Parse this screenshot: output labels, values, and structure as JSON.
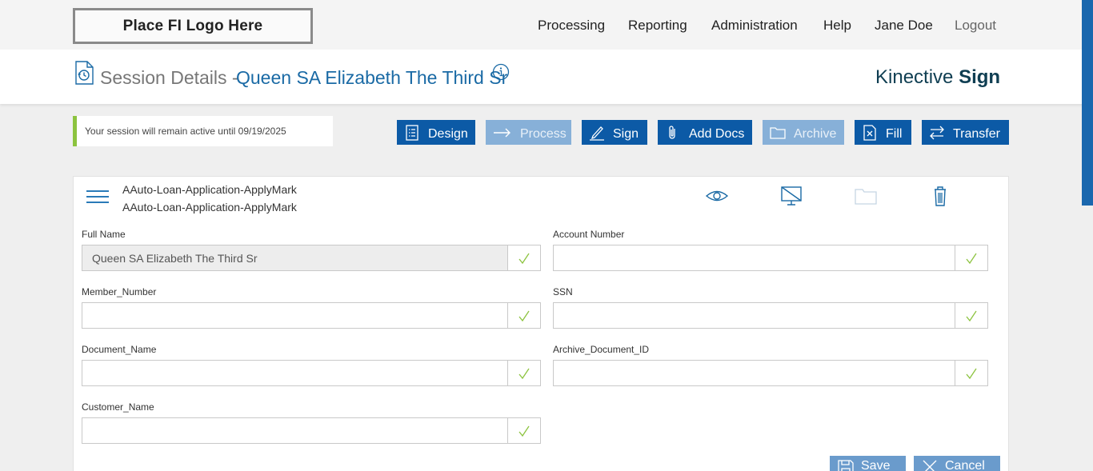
{
  "header": {
    "logo_text": "Place FI Logo Here",
    "nav": {
      "processing": "Processing",
      "reporting": "Reporting",
      "administration": "Administration",
      "help": "Help",
      "user": "Jane Doe",
      "logout": "Logout"
    }
  },
  "subheader": {
    "title_prefix": "Session Details -",
    "session_name": "Queen SA Elizabeth The Third Sr",
    "brand_light": "Kinective",
    "brand_bold": "Sign"
  },
  "session_notice": "Your session will remain active until 09/19/2025",
  "toolbar": {
    "design": "Design",
    "process": "Process",
    "sign": "Sign",
    "add_docs": "Add Docs",
    "archive": "Archive",
    "fill": "Fill",
    "transfer": "Transfer"
  },
  "document": {
    "line1": "AAuto-Loan-Application-ApplyMark",
    "line2": "AAuto-Loan-Application-ApplyMark"
  },
  "fields": {
    "full_name": {
      "label": "Full Name",
      "value": "Queen SA Elizabeth The Third Sr"
    },
    "account_number": {
      "label": "Account Number",
      "value": ""
    },
    "member_number": {
      "label": "Member_Number",
      "value": ""
    },
    "ssn": {
      "label": "SSN",
      "value": ""
    },
    "document_name": {
      "label": "Document_Name",
      "value": ""
    },
    "archive_document_id": {
      "label": "Archive_Document_ID",
      "value": ""
    },
    "customer_name": {
      "label": "Customer_Name",
      "value": ""
    }
  },
  "actions": {
    "save": "Save",
    "cancel": "Cancel"
  },
  "colors": {
    "primary": "#0c5aa6",
    "disabled": "#87b0d8",
    "title_blue": "#1a6aa5",
    "accent_green": "#8cc33f",
    "check_green": "#8cc33f"
  }
}
